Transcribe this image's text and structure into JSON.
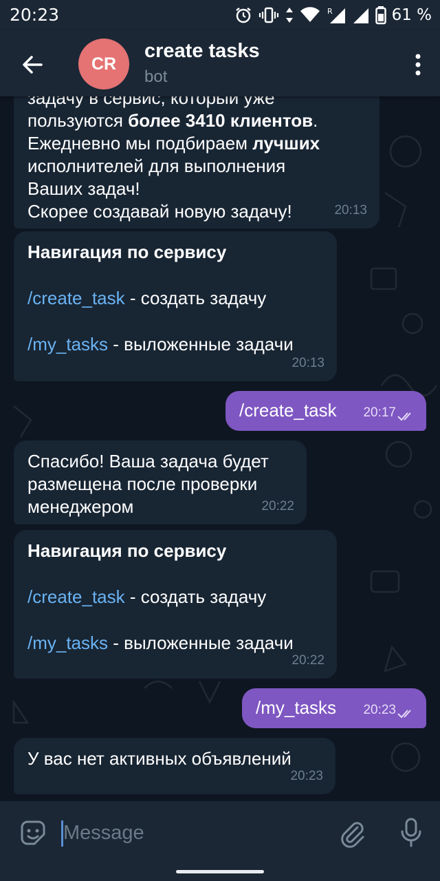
{
  "status_bar": {
    "time": "20:23",
    "battery": "61 %"
  },
  "header": {
    "avatar_initials": "CR",
    "title": "create tasks",
    "subtitle": "bot"
  },
  "messages": [
    {
      "lines_top": "задачу в сервис, который уже",
      "p1": "пользуются ",
      "p1_bold": "более 3410 клиентов",
      "p2": "Ежедневно мы подбираем ",
      "p2_bold": "лучших",
      "p3": "исполнителей для выполнения",
      "p4": "Ваших задач!",
      "p5": "Скорее создавай новую задачу!",
      "time": "20:13"
    },
    {
      "title": "Навигация по сервису",
      "cmd1": "/create_task",
      "cmd1_desc": " - создать задачу",
      "cmd2": "/my_tasks",
      "cmd2_desc": " - выложенные задачи",
      "time": "20:13"
    },
    {
      "text": "/create_task",
      "time": "20:17"
    },
    {
      "text": "Спасибо! Ваша задача будет размещена после проверки менеджером",
      "time": "20:22"
    },
    {
      "title": "Навигация по сервису",
      "cmd1": "/create_task",
      "cmd1_desc": " - создать задачу",
      "cmd2": "/my_tasks",
      "cmd2_desc": " - выложенные задачи",
      "time": "20:22"
    },
    {
      "text": "/my_tasks",
      "time": "20:23"
    },
    {
      "text": "У вас нет активных объявлений",
      "time": "20:23"
    }
  ],
  "input": {
    "placeholder": "Message"
  },
  "colors": {
    "background": "#0e1621",
    "bar": "#1b2735",
    "incoming": "#182533",
    "outgoing": "#7e57c2",
    "link": "#6ab3f3",
    "avatar": "#e57373"
  }
}
